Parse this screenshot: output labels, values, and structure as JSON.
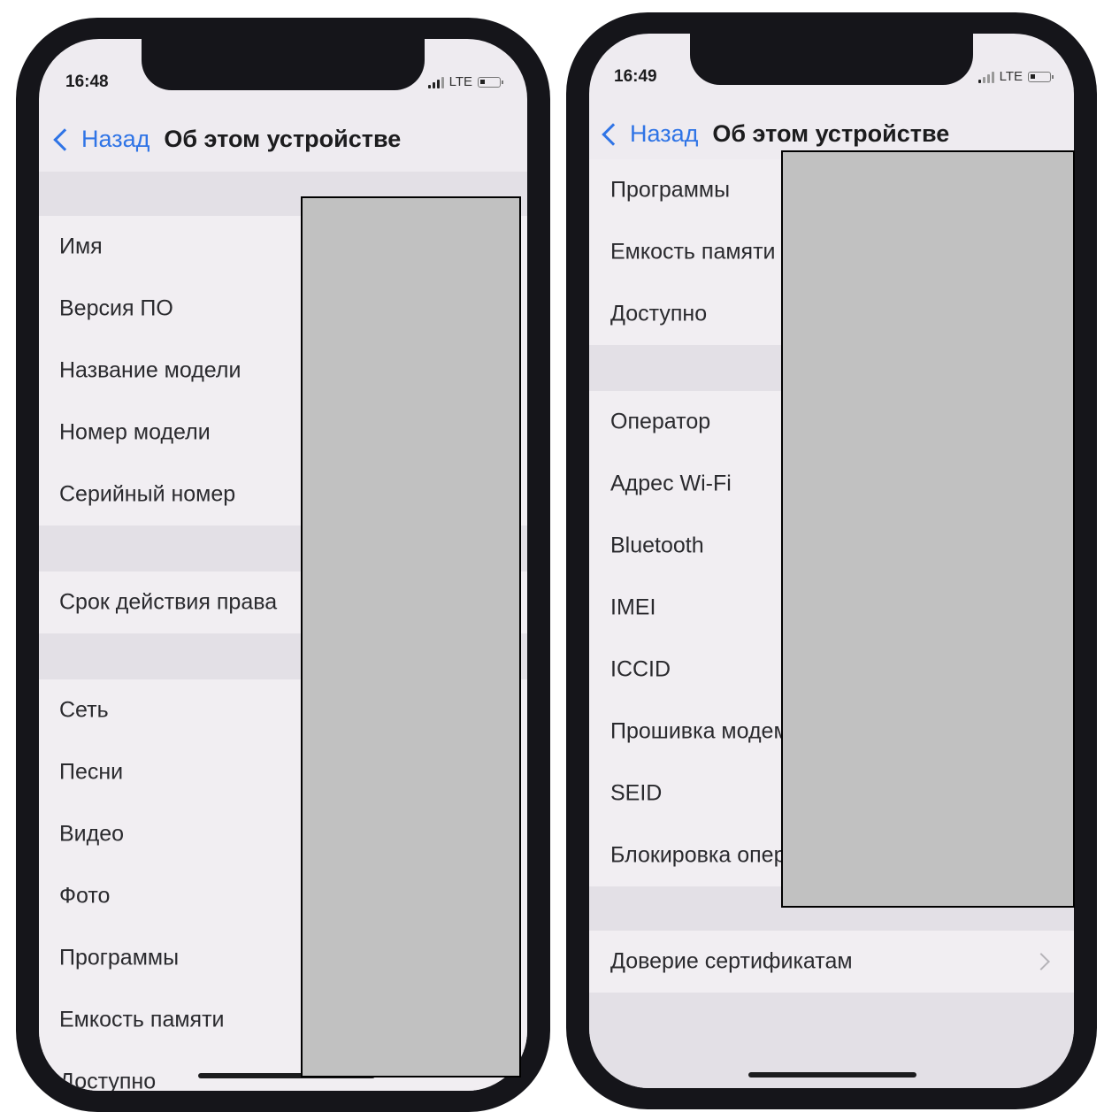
{
  "left_phone": {
    "status": {
      "time": "16:48",
      "network": "LTE"
    },
    "nav": {
      "back_label": "Назад",
      "title": "Об этом устройстве"
    },
    "rows": [
      "Имя",
      "Версия ПО",
      "Название модели",
      "Номер модели",
      "Серийный номер",
      "Срок действия права",
      "Сеть",
      "Песни",
      "Видео",
      "Фото",
      "Программы",
      "Емкость памяти",
      "Доступно"
    ]
  },
  "right_phone": {
    "status": {
      "time": "16:49",
      "network": "LTE"
    },
    "nav": {
      "back_label": "Назад",
      "title": "Об этом устройстве"
    },
    "rows": [
      "Программы",
      "Емкость памяти",
      "Доступно",
      "Оператор",
      "Адрес Wi-Fi",
      "Bluetooth",
      "IMEI",
      "ICCID",
      "Прошивка модема",
      "SEID",
      "Блокировка оператора"
    ],
    "trust_row": "Доверие сертификатам"
  },
  "colors": {
    "accent": "#2f74e6",
    "screen_bg": "#eeebf0",
    "redaction": "#c1c1c1"
  }
}
